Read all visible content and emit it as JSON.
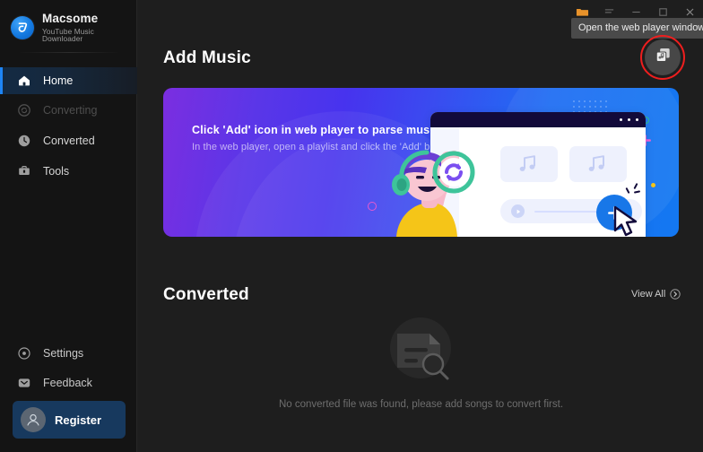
{
  "app": {
    "brand_name": "Macsome",
    "brand_subtitle": "YouTube Music Downloader",
    "brand_logo_icon": "macsome-logo-icon"
  },
  "titlebar": {
    "buttons": [
      {
        "name": "folder-icon",
        "label": ""
      },
      {
        "name": "menu-icon",
        "label": ""
      },
      {
        "name": "minimize-icon",
        "label": ""
      },
      {
        "name": "maximize-icon",
        "label": ""
      },
      {
        "name": "close-icon",
        "label": ""
      }
    ]
  },
  "tooltip": {
    "text": "Open the web player window."
  },
  "sidebar": {
    "items": [
      {
        "label": "Home",
        "icon": "home-icon",
        "state": "active"
      },
      {
        "label": "Converting",
        "icon": "refresh-icon",
        "state": "disabled"
      },
      {
        "label": "Converted",
        "icon": "clock-icon",
        "state": "normal"
      },
      {
        "label": "Tools",
        "icon": "toolbox-icon",
        "state": "normal"
      }
    ],
    "bottom_items": [
      {
        "label": "Settings",
        "icon": "gear-icon"
      },
      {
        "label": "Feedback",
        "icon": "message-icon"
      }
    ],
    "register": {
      "label": "Register",
      "icon": "user-avatar-icon"
    }
  },
  "main": {
    "add_music": {
      "title": "Add Music",
      "web_player_button_icon": "web-player-window-icon"
    },
    "banner": {
      "title": "Click 'Add' icon in web player to parse music",
      "subtitle": "In the web player, open a playlist and click the 'Add' button"
    },
    "converted": {
      "title": "Converted",
      "view_all_label": "View All",
      "view_all_icon": "chevron-right-circle-icon",
      "empty_icon": "document-search-icon",
      "empty_text": "No converted file was found, please add songs to convert first."
    }
  },
  "colors": {
    "accent_blue": "#1e85f5",
    "sidebar_bg": "#141414",
    "main_bg": "#1e1e1e",
    "banner_start": "#7b2ee0",
    "banner_end": "#1378f2",
    "highlight_ring": "#ef1e1e",
    "register_bg": "#17395e",
    "plus_button": "#1877e8"
  }
}
